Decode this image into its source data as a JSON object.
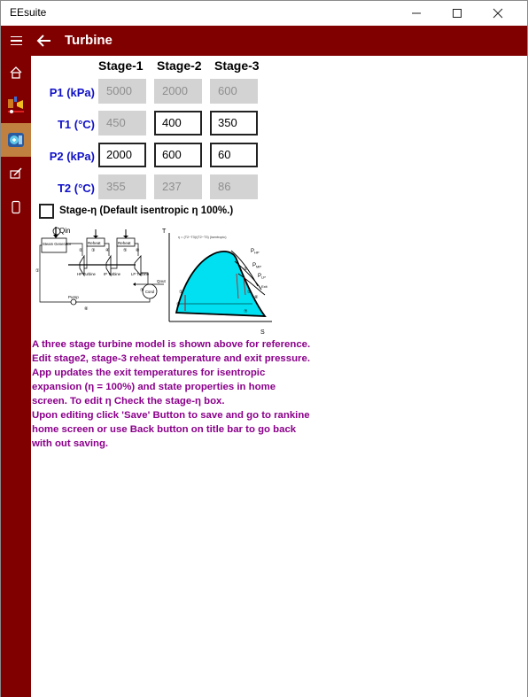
{
  "window": {
    "title": "EEsuite",
    "controls": {
      "minimize": "—",
      "maximize": "☐",
      "close": "✕"
    }
  },
  "header": {
    "title": "Turbine"
  },
  "nav": [
    "home-icon",
    "rankine-cycle-icon",
    "turbine-icon",
    "edit-icon",
    "device-icon"
  ],
  "table": {
    "stages": [
      "Stage-1",
      "Stage-2",
      "Stage-3"
    ],
    "rows": [
      {
        "label": "P1 (kPa)",
        "values": [
          "5000",
          "2000",
          "600"
        ],
        "editable": [
          false,
          false,
          false
        ]
      },
      {
        "label": "T1 (°C)",
        "values": [
          "450",
          "400",
          "350"
        ],
        "editable": [
          false,
          true,
          true
        ]
      },
      {
        "label": "P2 (kPa)",
        "values": [
          "2000",
          "600",
          "60"
        ],
        "editable": [
          true,
          true,
          true
        ]
      },
      {
        "label": "T2 (°C)",
        "values": [
          "355",
          "237",
          "86"
        ],
        "editable": [
          false,
          false,
          false
        ]
      }
    ]
  },
  "efficiency": {
    "label": "Stage-η (Default isentropic η 100%.)",
    "checked": false
  },
  "diagram": {
    "schematic": {
      "qin": "Qin",
      "steam_generator": "Steam Generator",
      "reheat": "Reheat",
      "hp_turbine": "HP Turbine",
      "ip_turbine": "IP Turbine",
      "lp_turbine": "LP Turbine",
      "cond": "Cond",
      "qout": "Qout",
      "pump": "Pump",
      "state_numbers": [
        "①",
        "②",
        "③",
        "④",
        "⑤",
        "⑥",
        "⑦",
        "⑧"
      ]
    },
    "ts": {
      "t_axis": "T",
      "s_axis": "S",
      "formula": "η = (T2−T3)/(T2−T3) (isentropic)",
      "p_hp": "P",
      "sub_hp": "HP",
      "p_ip": "P",
      "sub_ip": "MP",
      "p_lp": "P",
      "sub_lp": "LP",
      "exit_label": "Exit",
      "fill_color": "#00e0f0"
    }
  },
  "description": [
    "A three stage turbine model is shown above for reference.  Edit stage2, stage-3 reheat temperature and exit pressure.  App updates the exit temperatures for isentropic expansion (η = 100%) and state properties in home screen.  To edit η Check the stage-η box.",
    "Upon editing click 'Save' Button to save and go to rankine home screen or use Back button on title bar to go back with out saving."
  ],
  "colors": {
    "accent": "#800000",
    "nav_selected": "#c08040",
    "label_blue": "#1010c8",
    "desc_purple": "#8b008b"
  }
}
